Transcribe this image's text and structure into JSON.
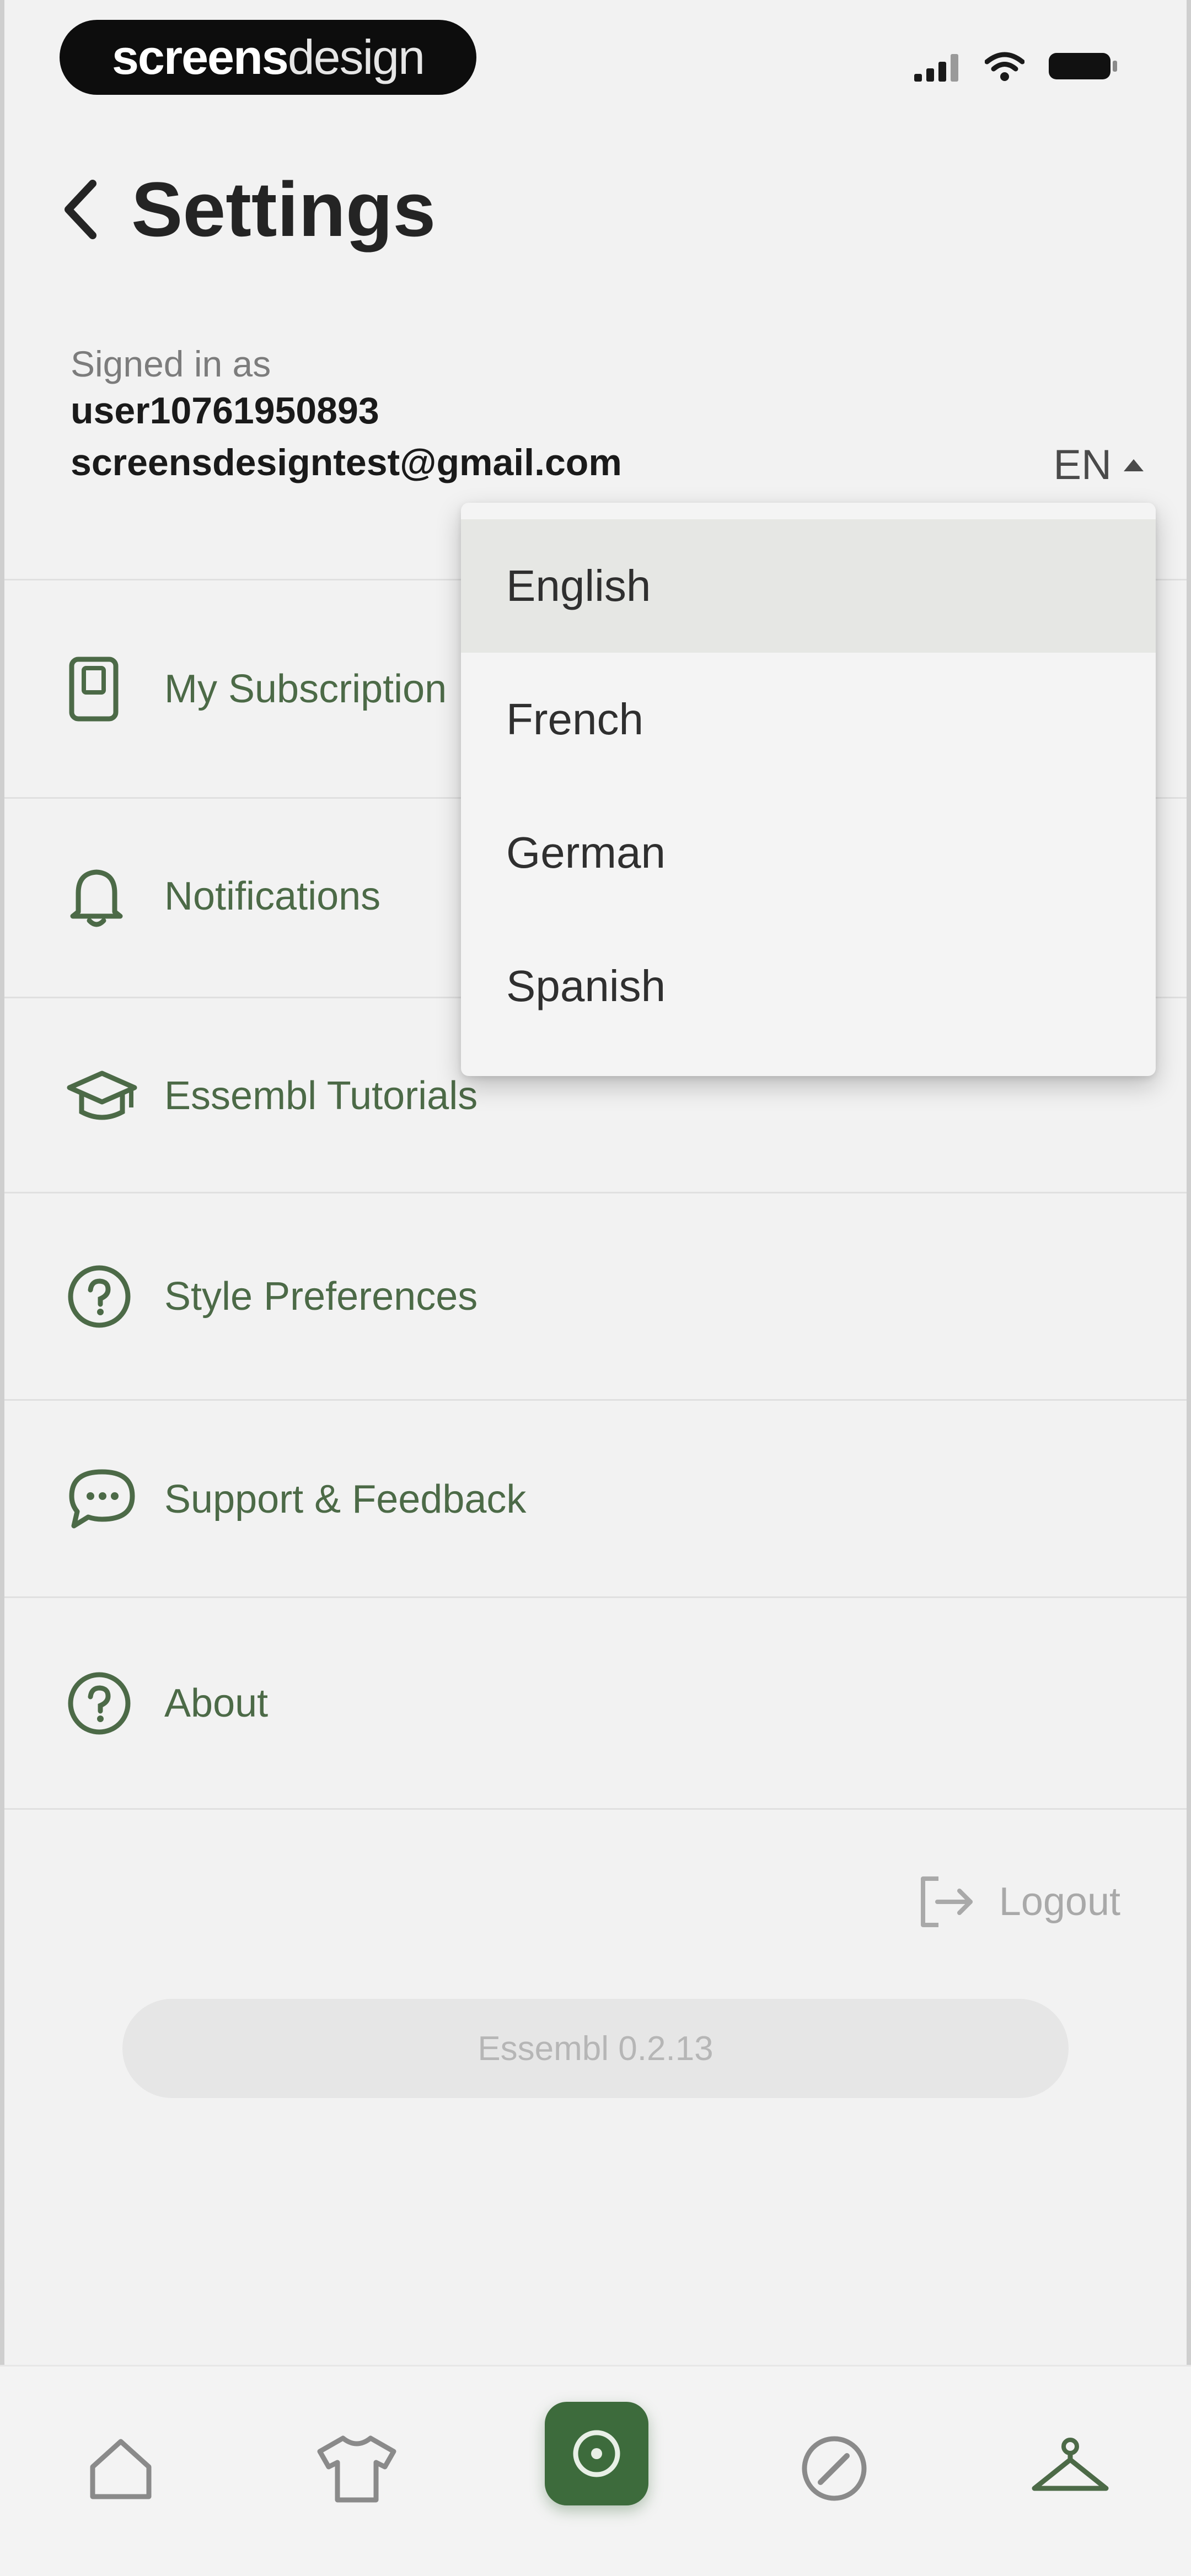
{
  "status_bar": {
    "brand_bold": "screens",
    "brand_light": "design",
    "icons": [
      "signal-icon",
      "wifi-icon",
      "battery-icon"
    ]
  },
  "header": {
    "title": "Settings",
    "back_icon": "chevron-left-icon"
  },
  "account": {
    "signed_in_label": "Signed in as",
    "username": "user10761950893",
    "email": "screensdesigntest@gmail.com",
    "language_code": "EN"
  },
  "language_dropdown": {
    "options": [
      "English",
      "French",
      "German",
      "Spanish"
    ],
    "selected": "English"
  },
  "settings_rows": [
    {
      "label": "My Subscription",
      "icon": "subscription-card-icon"
    },
    {
      "label": "Notifications",
      "icon": "bell-icon"
    },
    {
      "label": "Essembl Tutorials",
      "icon": "graduation-cap-icon"
    },
    {
      "label": "Style Preferences",
      "icon": "help-circle-icon"
    },
    {
      "label": "Support & Feedback",
      "icon": "chat-bubble-icon"
    },
    {
      "label": "About",
      "icon": "help-circle-icon"
    }
  ],
  "logout": {
    "label": "Logout",
    "icon": "logout-icon"
  },
  "version": "Essembl 0.2.13",
  "bottom_nav": [
    {
      "name": "home",
      "icon": "home-icon"
    },
    {
      "name": "wardrobe",
      "icon": "tshirt-icon"
    },
    {
      "name": "create",
      "icon": "plus-circle-icon",
      "active": true
    },
    {
      "name": "explore",
      "icon": "compass-icon"
    },
    {
      "name": "hanger",
      "icon": "hanger-icon"
    }
  ],
  "colors": {
    "accent": "#3d6b3c",
    "row_text": "#4c6a47",
    "background": "#f2f2f2"
  }
}
